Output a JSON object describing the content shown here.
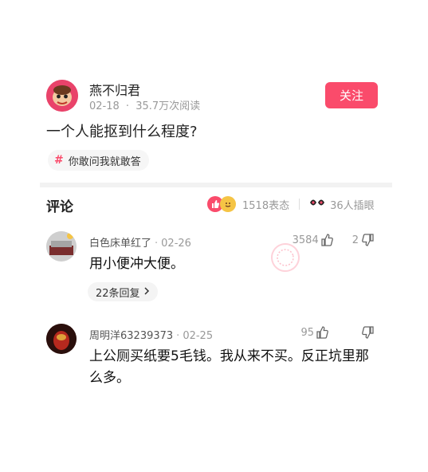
{
  "post": {
    "author": "燕不归君",
    "date": "02-18",
    "separator": "·",
    "reads": "35.7万次阅读",
    "follow_label": "关注",
    "title": "一个人能抠到什么程度?",
    "tag_symbol": "#",
    "tag": "你敢问我就敢答"
  },
  "comments_section": {
    "title": "评论",
    "reactions_count": "1518表态",
    "eyes_count": "36人插眼"
  },
  "comments": [
    {
      "user": "白色床单红了",
      "date": "02-26",
      "up": "3584",
      "down": "2",
      "body": "用小便冲大便。",
      "replies": "22条回复"
    },
    {
      "user": "周明洋63239373",
      "date": "02-25",
      "up": "95",
      "down": "",
      "body": "上公厕买纸要5毛钱。我从来不买。反正坑里那么多。"
    }
  ],
  "colors": {
    "accent": "#fa4b6b",
    "muted": "#999999",
    "text": "#222222"
  },
  "icons": {
    "hash": "hash-icon",
    "like": "like-reaction-icon",
    "funny": "funny-reaction-icon",
    "eyes": "eyes-icon",
    "thumb_up": "thumb-up-icon",
    "thumb_down": "thumb-down-icon",
    "chevron": "chevron-right-icon"
  }
}
